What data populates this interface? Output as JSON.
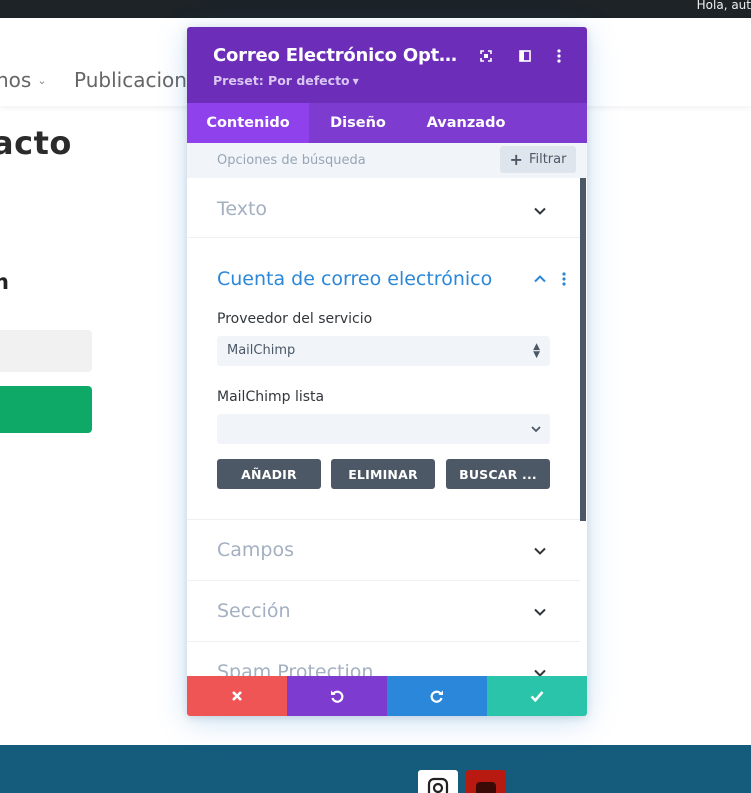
{
  "site": {
    "admin_greeting": "Hola, aut",
    "nav": [
      {
        "label": "nos"
      },
      {
        "label": "Publicacione"
      }
    ],
    "page_heading": "acto",
    "sub_heading": "n"
  },
  "modal": {
    "title": "Correo Electrónico Optin C...",
    "preset": "Preset: Por defecto",
    "header_icons": [
      "focus-icon",
      "split-view-icon",
      "more-vertical-icon"
    ],
    "tabs": [
      {
        "label": "Contenido",
        "active": true
      },
      {
        "label": "Diseño",
        "active": false
      },
      {
        "label": "Avanzado",
        "active": false
      }
    ],
    "search": {
      "placeholder": "Opciones de búsqueda",
      "filter_label": "Filtrar"
    },
    "sections": {
      "texto": "Texto",
      "cuenta": "Cuenta de correo electrónico",
      "campos": "Campos",
      "seccion": "Sección",
      "spam": "Spam Protection"
    },
    "cuenta_fields": {
      "provider_label": "Proveedor del servicio",
      "provider_value": "MailChimp",
      "list_label": "MailChimp lista",
      "list_value": ""
    },
    "actions": {
      "add": "AÑADIR",
      "remove": "ELIMINAR",
      "search": "BUSCAR ..."
    },
    "footer_buttons": [
      {
        "name": "discard",
        "icon": "close-icon",
        "color": "#ef5555"
      },
      {
        "name": "undo",
        "icon": "undo-icon",
        "color": "#7e3bd0"
      },
      {
        "name": "redo",
        "icon": "redo-icon",
        "color": "#2b87da"
      },
      {
        "name": "save",
        "icon": "check-icon",
        "color": "#29c4a9"
      }
    ]
  },
  "colors": {
    "header_purple": "#6c2eb9",
    "tab_purple": "#7e3bd0",
    "accent_blue": "#2b87da",
    "footer_teal": "#155b7c",
    "green_button": "#0ea966"
  }
}
